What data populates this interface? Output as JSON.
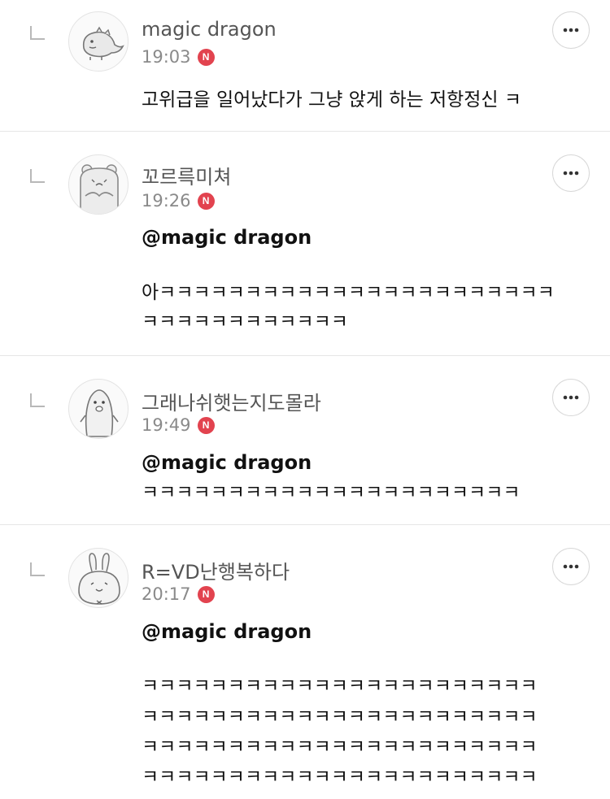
{
  "comments": [
    {
      "author": "magic dragon",
      "time": "19:03",
      "badge": "N",
      "avatar_icon": "dinosaur-avatar-icon",
      "mention": "",
      "lines": [
        "고위급을 일어났다가 그냥 앉게 하는 저항정신 ㅋ"
      ]
    },
    {
      "author": "꼬르륵미쳐",
      "time": "19:26",
      "badge": "N",
      "avatar_icon": "bear-avatar-icon",
      "mention": "@magic dragon",
      "lines": [
        "아ㅋㅋㅋㅋㅋㅋㅋㅋㅋㅋㅋㅋㅋㅋㅋㅋㅋㅋㅋㅋㅋㅋㅋ",
        "ㅋㅋㅋㅋㅋㅋㅋㅋㅋㅋㅋㅋ"
      ]
    },
    {
      "author": "그래나쉬햇는지도몰라",
      "time": "19:49",
      "badge": "N",
      "avatar_icon": "penguin-avatar-icon",
      "mention": "@magic dragon",
      "lines": [
        " ㅋㅋㅋㅋㅋㅋㅋㅋㅋㅋㅋㅋㅋㅋㅋㅋㅋㅋㅋㅋㅋㅋ"
      ]
    },
    {
      "author": "R=VD난행복하다",
      "time": "20:17",
      "badge": "N",
      "avatar_icon": "rabbit-avatar-icon",
      "mention": "@magic dragon",
      "lines": [
        "ㅋㅋㅋㅋㅋㅋㅋㅋㅋㅋㅋㅋㅋㅋㅋㅋㅋㅋㅋㅋㅋㅋㅋ",
        "ㅋㅋㅋㅋㅋㅋㅋㅋㅋㅋㅋㅋㅋㅋㅋㅋㅋㅋㅋㅋㅋㅋㅋ",
        "ㅋㅋㅋㅋㅋㅋㅋㅋㅋㅋㅋㅋㅋㅋㅋㅋㅋㅋㅋㅋㅋㅋㅋ",
        "ㅋㅋㅋㅋㅋㅋㅋㅋㅋㅋㅋㅋㅋㅋㅋㅋㅋㅋㅋㅋㅋㅋㅋ"
      ]
    }
  ],
  "colors": {
    "badge": "#e2434f",
    "divider": "#e6e6e6",
    "author": "#555555",
    "time": "#8a8a8a"
  }
}
